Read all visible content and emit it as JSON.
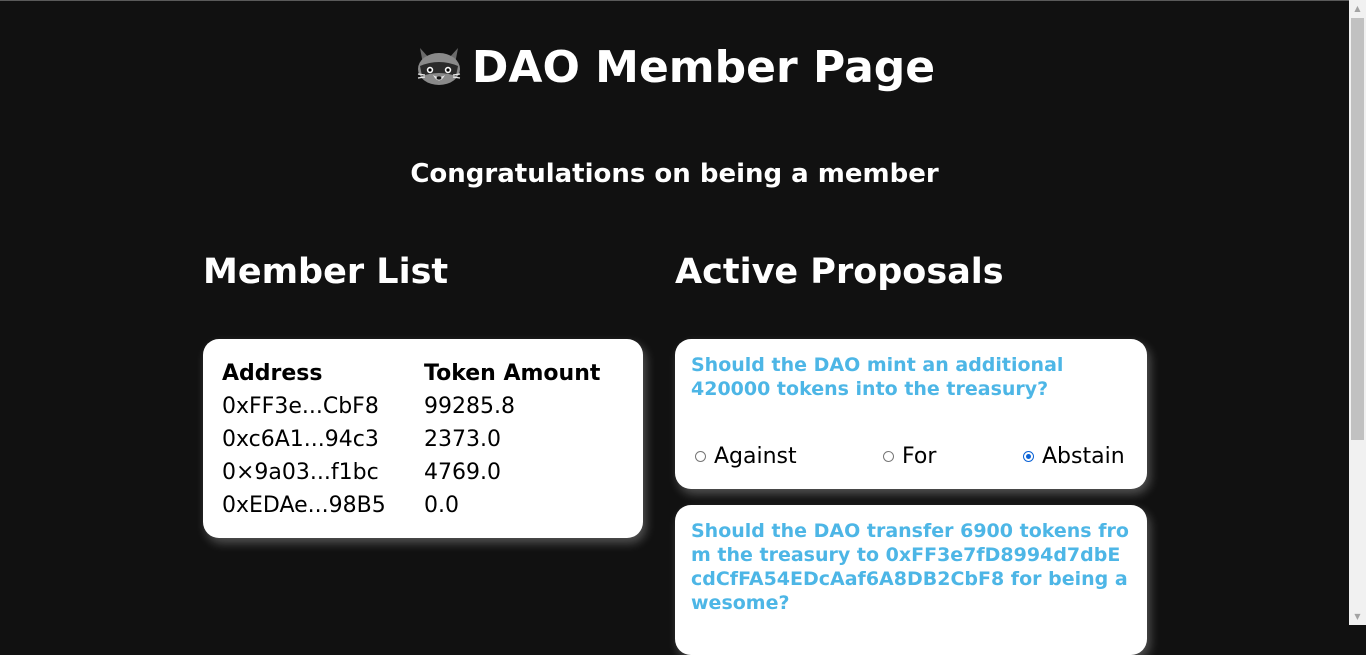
{
  "header": {
    "title": "DAO Member Page",
    "subtitle": "Congratulations on being a member"
  },
  "members": {
    "heading": "Member List",
    "columns": [
      "Address",
      "Token Amount"
    ],
    "rows": [
      [
        "0xFF3e...CbF8",
        "99285.8"
      ],
      [
        "0xc6A1...94c3",
        "2373.0"
      ],
      [
        "0×9a03...f1bc",
        "4769.0"
      ],
      [
        "0xEDAe...98B5",
        "0.0"
      ]
    ]
  },
  "proposals": {
    "heading": "Active Proposals",
    "items": [
      {
        "text": "Should the DAO mint an additional 420000 tokens into the treasury?",
        "options": [
          "Against",
          "For",
          "Abstain"
        ],
        "selected": "Abstain"
      },
      {
        "text": "Should the DAO transfer 6900 tokens from the treasury to 0xFF3e7fD8994d7dbEcdCfFA54EDcAaf6A8DB2CbF8 for being awesome?"
      }
    ]
  },
  "colors": {
    "background": "#111111",
    "card": "#ffffff",
    "proposal_text": "#4db6e6",
    "radio_selected": "#0b63d6"
  },
  "icons": {
    "logo": "raccoon-icon",
    "scroll_up": "scroll-up-arrow-icon",
    "scroll_down": "scroll-down-arrow-icon"
  }
}
